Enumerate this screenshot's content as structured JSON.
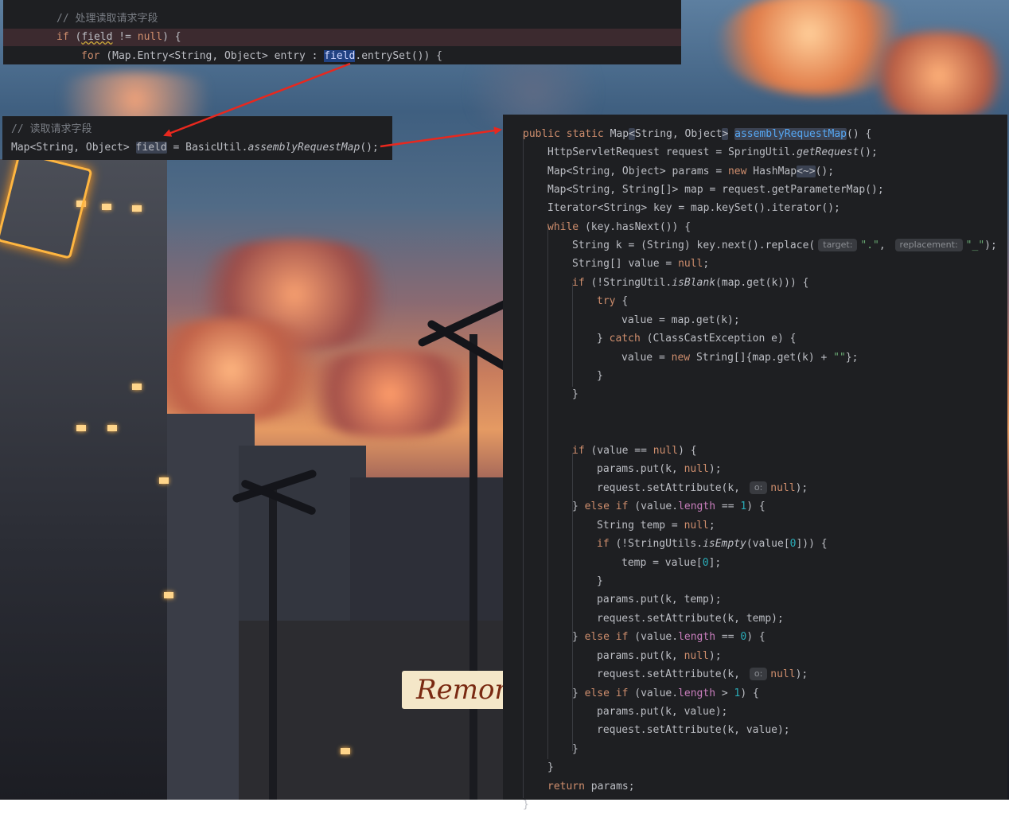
{
  "top_panel": {
    "comment": "// 处理读取请求字段",
    "line2": {
      "kw_if": "if",
      "open": " (",
      "var": "field",
      "mid": " != ",
      "null": "null",
      "close": ") {"
    },
    "line3": {
      "kw_for": "for",
      "pre": " (Map.Entry<String, Object> entry : ",
      "sel": "field",
      "post": ".entrySet()) {"
    }
  },
  "mid_panel": {
    "comment": "// 读取请求字段",
    "decl": "Map<String, Object> ",
    "var": "field",
    "eq": " = BasicUtil.",
    "call": "assemblyRequestMap",
    "end": "();"
  },
  "right_panel": {
    "lines": [
      {
        "parts": [
          [
            "kw",
            "public static "
          ],
          [
            "t",
            "Map"
          ],
          [
            "hl",
            "<"
          ],
          [
            "t",
            "String, Object"
          ],
          [
            "hl",
            ">"
          ],
          [
            "t",
            " "
          ],
          [
            "fnhl",
            "assemblyRequestMap"
          ],
          [
            "t",
            "() {"
          ]
        ]
      },
      {
        "parts": [
          [
            "t",
            "HttpServletRequest request = SpringUtil."
          ],
          [
            "it",
            "getRequest"
          ],
          [
            "t",
            "();"
          ]
        ]
      },
      {
        "parts": [
          [
            "t",
            "Map<String, Object> params = "
          ],
          [
            "kw",
            "new "
          ],
          [
            "t",
            "HashMap"
          ],
          [
            "hl",
            "<~>"
          ],
          [
            "t",
            "();"
          ]
        ]
      },
      {
        "parts": [
          [
            "t",
            "Map<String, String[]> map = request.getParameterMap();"
          ]
        ]
      },
      {
        "parts": [
          [
            "t",
            "Iterator<String> key = map.keySet().iterator();"
          ]
        ]
      },
      {
        "parts": [
          [
            "kw",
            "while "
          ],
          [
            "t",
            "(key.hasNext()) {"
          ]
        ]
      },
      {
        "parts": [
          [
            "t",
            "String k = (String) key.next().replace("
          ],
          [
            "hint",
            "target:"
          ],
          [
            "str",
            "\".\""
          ],
          [
            "t",
            ", "
          ],
          [
            "hint",
            "replacement:"
          ],
          [
            "str",
            "\"_\""
          ],
          [
            "t",
            ");"
          ]
        ]
      },
      {
        "parts": [
          [
            "t",
            "String[] value = "
          ],
          [
            "kw",
            "null"
          ],
          [
            "t",
            ";"
          ]
        ]
      },
      {
        "parts": [
          [
            "kw",
            "if "
          ],
          [
            "t",
            "(!StringUtil."
          ],
          [
            "it",
            "isBlank"
          ],
          [
            "t",
            "(map.get(k))) {"
          ]
        ]
      },
      {
        "parts": [
          [
            "kw",
            "try "
          ],
          [
            "t",
            "{"
          ]
        ]
      },
      {
        "parts": [
          [
            "t",
            "value = map.get(k);"
          ]
        ]
      },
      {
        "parts": [
          [
            "t",
            "} "
          ],
          [
            "kw",
            "catch "
          ],
          [
            "t",
            "(ClassCastException e) {"
          ]
        ]
      },
      {
        "parts": [
          [
            "t",
            "value = "
          ],
          [
            "kw",
            "new "
          ],
          [
            "t",
            "String[]{map.get(k) + "
          ],
          [
            "str",
            "\"\""
          ],
          [
            "t",
            "};"
          ]
        ]
      },
      {
        "parts": [
          [
            "t",
            "}"
          ]
        ]
      },
      {
        "parts": [
          [
            "t",
            "}"
          ]
        ]
      },
      {
        "parts": [
          [
            "kw",
            "if "
          ],
          [
            "t",
            "(value == "
          ],
          [
            "kw",
            "null"
          ],
          [
            "t",
            ") {"
          ]
        ]
      },
      {
        "parts": [
          [
            "t",
            "params.put(k, "
          ],
          [
            "kw",
            "null"
          ],
          [
            "t",
            ");"
          ]
        ]
      },
      {
        "parts": [
          [
            "t",
            "request.setAttribute(k, "
          ],
          [
            "hint",
            "o:"
          ],
          [
            "kw",
            "null"
          ],
          [
            "t",
            ");"
          ]
        ]
      },
      {
        "parts": [
          [
            "t",
            "} "
          ],
          [
            "kw",
            "else if "
          ],
          [
            "t",
            "(value."
          ],
          [
            "fld",
            "length"
          ],
          [
            "t",
            " == "
          ],
          [
            "num",
            "1"
          ],
          [
            "t",
            ") {"
          ]
        ]
      },
      {
        "parts": [
          [
            "t",
            "String temp = "
          ],
          [
            "kw",
            "null"
          ],
          [
            "t",
            ";"
          ]
        ]
      },
      {
        "parts": [
          [
            "kw",
            "if "
          ],
          [
            "t",
            "(!StringUtils."
          ],
          [
            "it",
            "isEmpty"
          ],
          [
            "t",
            "(value["
          ],
          [
            "num",
            "0"
          ],
          [
            "t",
            "])) {"
          ]
        ]
      },
      {
        "parts": [
          [
            "t",
            "temp = value["
          ],
          [
            "num",
            "0"
          ],
          [
            "t",
            "];"
          ]
        ]
      },
      {
        "parts": [
          [
            "t",
            "}"
          ]
        ]
      },
      {
        "parts": [
          [
            "t",
            "params.put(k, temp);"
          ]
        ]
      },
      {
        "parts": [
          [
            "t",
            "request.setAttribute(k, temp);"
          ]
        ]
      },
      {
        "parts": [
          [
            "t",
            "} "
          ],
          [
            "kw",
            "else if "
          ],
          [
            "t",
            "(value."
          ],
          [
            "fld",
            "length"
          ],
          [
            "t",
            " == "
          ],
          [
            "num",
            "0"
          ],
          [
            "t",
            ") {"
          ]
        ]
      },
      {
        "parts": [
          [
            "t",
            "params.put(k, "
          ],
          [
            "kw",
            "null"
          ],
          [
            "t",
            ");"
          ]
        ]
      },
      {
        "parts": [
          [
            "t",
            "request.setAttribute(k, "
          ],
          [
            "hint",
            "o:"
          ],
          [
            "kw",
            "null"
          ],
          [
            "t",
            ");"
          ]
        ]
      },
      {
        "parts": [
          [
            "t",
            "} "
          ],
          [
            "kw",
            "else if "
          ],
          [
            "t",
            "(value."
          ],
          [
            "fld",
            "length"
          ],
          [
            "t",
            " > "
          ],
          [
            "num",
            "1"
          ],
          [
            "t",
            ") {"
          ]
        ]
      },
      {
        "parts": [
          [
            "t",
            "params.put(k, value);"
          ]
        ]
      },
      {
        "parts": [
          [
            "t",
            "request.setAttribute(k, value);"
          ]
        ]
      },
      {
        "parts": [
          [
            "t",
            "}"
          ]
        ]
      },
      {
        "parts": [
          [
            "t",
            "}"
          ]
        ]
      },
      {
        "parts": [
          [
            "kw",
            "return "
          ],
          [
            "t",
            "params;"
          ]
        ]
      },
      {
        "parts": [
          [
            "t",
            "}"
          ]
        ]
      }
    ]
  },
  "background": {
    "sign_text": "Remonsa"
  },
  "colors": {
    "editor_bg": "#1e1f22",
    "keyword": "#cf8e6d",
    "comment": "#7a7e85",
    "number": "#2aacb8",
    "string": "#6aab73",
    "function": "#56a8f5",
    "field": "#c77dbb",
    "arrow": "#e8281e"
  }
}
